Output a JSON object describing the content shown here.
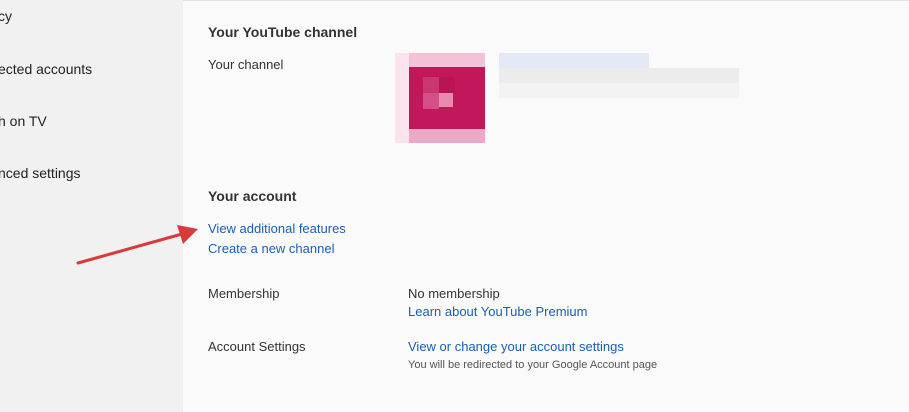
{
  "sidebar": {
    "items": [
      {
        "label": "cy"
      },
      {
        "label": "ected accounts"
      },
      {
        "label": "h on TV"
      },
      {
        "label": "nced settings"
      }
    ]
  },
  "channel_section": {
    "title": "Your YouTube channel",
    "channel_label": "Your channel",
    "avatar_icon": "channel-avatar-icon"
  },
  "account_section": {
    "title": "Your account",
    "view_features_link": "View additional features",
    "create_channel_link": "Create a new channel"
  },
  "membership": {
    "label": "Membership",
    "status": "No membership",
    "learn_link": "Learn about YouTube Premium"
  },
  "account_settings": {
    "label": "Account Settings",
    "link": "View or change your account settings",
    "note": "You will be redirected to your Google Account page"
  },
  "colors": {
    "link": "#1a5fb4",
    "avatar": "#c2185b",
    "annotation_arrow": "#d93a3a"
  }
}
